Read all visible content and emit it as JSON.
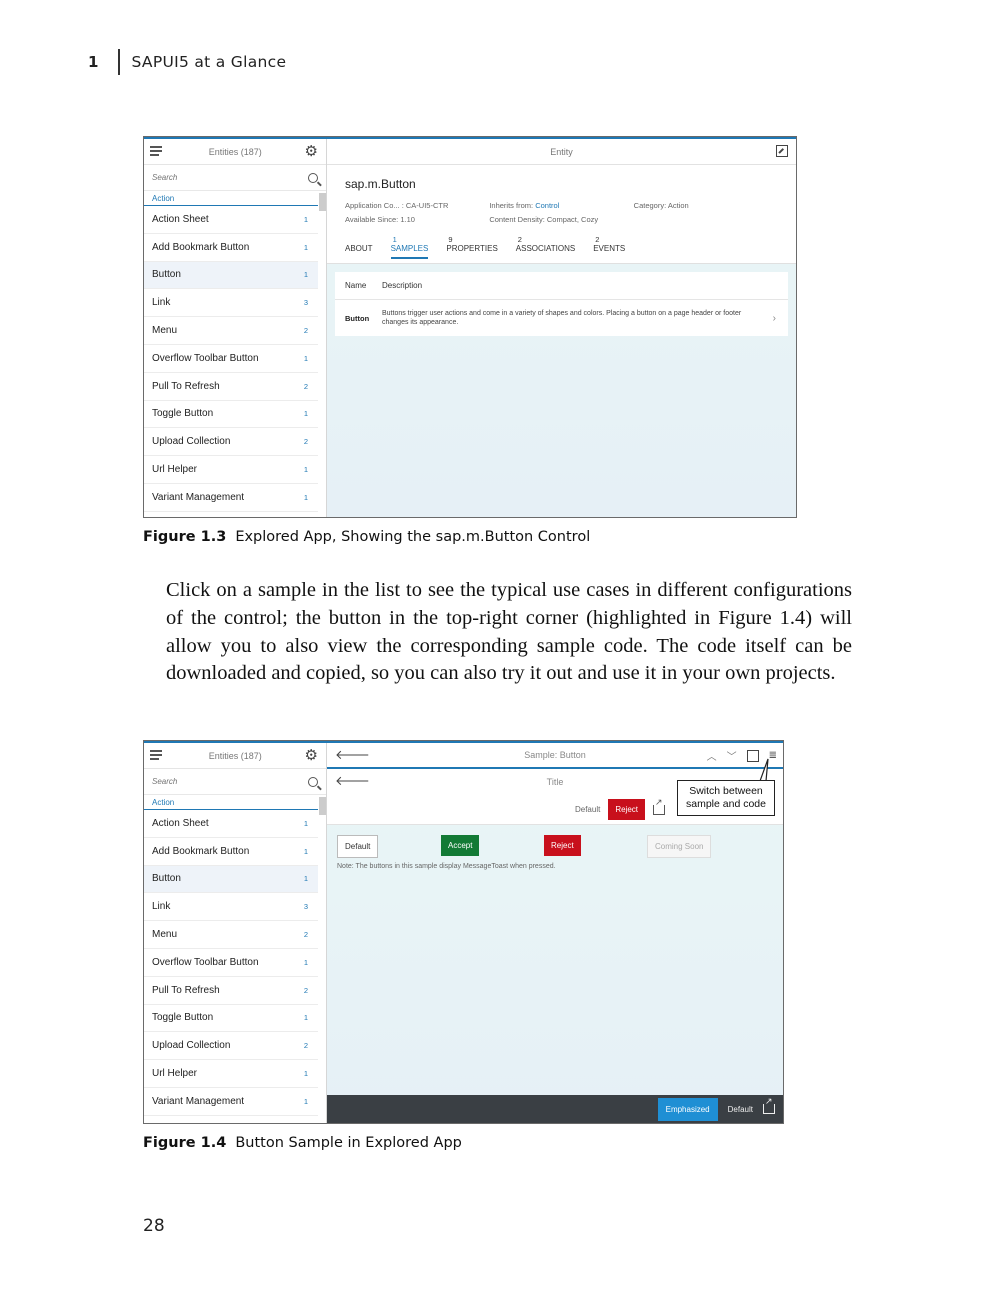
{
  "running_head": {
    "chapter": "1",
    "title": "SAPUI5 at a Glance"
  },
  "sidebar": {
    "entities_label": "Entities (187)",
    "search_placeholder": "Search",
    "group": "Action",
    "items": [
      {
        "label": "Action Sheet",
        "count": "1"
      },
      {
        "label": "Add Bookmark Button",
        "count": "1"
      },
      {
        "label": "Button",
        "count": "1"
      },
      {
        "label": "Link",
        "count": "3"
      },
      {
        "label": "Menu",
        "count": "2"
      },
      {
        "label": "Overflow Toolbar Button",
        "count": "1"
      },
      {
        "label": "Pull To Refresh",
        "count": "2"
      },
      {
        "label": "Toggle Button",
        "count": "1"
      },
      {
        "label": "Upload Collection",
        "count": "2"
      },
      {
        "label": "Url Helper",
        "count": "1"
      },
      {
        "label": "Variant Management",
        "count": "1"
      }
    ]
  },
  "figure1": {
    "header_title": "Entity",
    "object_title": "sap.m.Button",
    "attrs": {
      "app_component": "Application Co... : CA-UI5-CTR",
      "available_since": "Available Since: 1.10",
      "inherits_label": "Inherits from:",
      "inherits_link": "Control",
      "content_density": "Content Density: Compact, Cozy",
      "category": "Category: Action"
    },
    "tabs": [
      {
        "count": "",
        "label": "ABOUT"
      },
      {
        "count": "1",
        "label": "SAMPLES"
      },
      {
        "count": "9",
        "label": "PROPERTIES"
      },
      {
        "count": "2",
        "label": "ASSOCIATIONS"
      },
      {
        "count": "2",
        "label": "EVENTS"
      }
    ],
    "table": {
      "col_name": "Name",
      "col_desc": "Description",
      "row_name": "Button",
      "row_desc": "Buttons trigger user actions and come in a variety of shapes and colors. Placing a button on a page header or footer changes its appearance."
    },
    "caption_label": "Figure 1.3",
    "caption_text": "Explored App, Showing the sap.m.Button Control"
  },
  "body_text": "Click on a sample in the list to see the typical use cases in different configurations of the control; the button in the top-right corner (highlighted in Figure 1.4) will allow you to also view the corresponding sample code. The code itself can be downloaded and copied, so you can also try it out and use it in your own projects.",
  "figure2": {
    "header_title": "Sample: Button",
    "sub_title": "Title",
    "toolbar": {
      "default": "Default",
      "reject": "Reject"
    },
    "buttons": {
      "default": "Default",
      "accept": "Accept",
      "reject": "Reject",
      "coming_soon": "Coming Soon"
    },
    "note": "Note: The buttons in this sample display MessageToast when pressed.",
    "footer": {
      "emphasized": "Emphasized",
      "default": "Default"
    },
    "callout_line1": "Switch between",
    "callout_line2": "sample and code",
    "caption_label": "Figure 1.4",
    "caption_text": "Button Sample in Explored App"
  },
  "page_number": "28"
}
